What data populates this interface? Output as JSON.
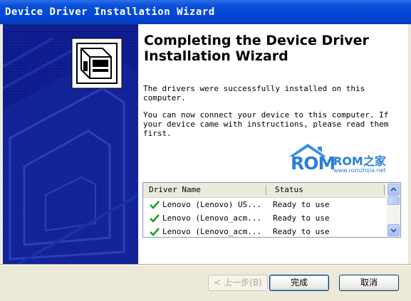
{
  "window": {
    "title": "Device Driver Installation Wizard"
  },
  "content": {
    "heading": "Completing the Device Driver Installation Wizard",
    "para1": "The drivers were successfully installed on this computer.",
    "para2": "You can now connect your device to this computer. If your device came with instructions, please read them first."
  },
  "watermark": {
    "rom": "ROM",
    "brand": "ROM之家",
    "url": "www.romzhijia.net"
  },
  "list": {
    "columns": [
      "Driver Name",
      "Status"
    ],
    "rows": [
      {
        "name": "Lenovo (Lenovo) US...",
        "status": "Ready to use"
      },
      {
        "name": "Lenovo (Lenovo_acm...",
        "status": "Ready to use"
      },
      {
        "name": "Lenovo (Lenovo_acm...",
        "status": "Ready to use"
      }
    ]
  },
  "buttons": {
    "back": "< 上一步(B)",
    "finish": "完成",
    "cancel": "取消"
  },
  "colors": {
    "titlebar": "#0046d5",
    "leftpanel": "#0d1b8c",
    "check": "#1e9e1e"
  }
}
